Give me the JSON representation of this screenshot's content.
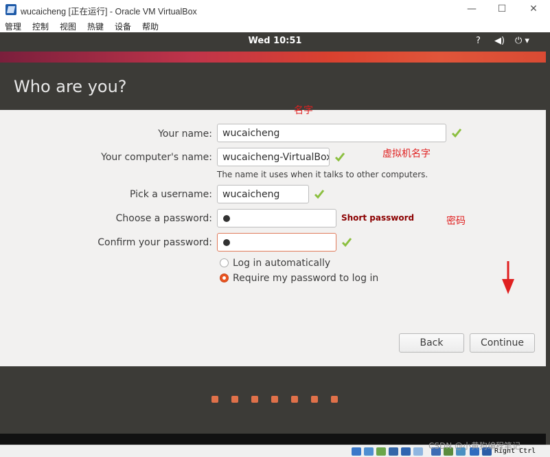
{
  "window": {
    "title": "wucaicheng [正在运行] - Oracle VM VirtualBox",
    "controls": {
      "minimize": "—",
      "maximize": "☐",
      "close": "✕"
    }
  },
  "menu": [
    "管理",
    "控制",
    "视图",
    "热键",
    "设备",
    "帮助"
  ],
  "topbar": {
    "clock": "Wed 10:51"
  },
  "installer": {
    "heading": "Who are you?",
    "your_name": {
      "label": "Your name:",
      "value": "wucaicheng"
    },
    "computer_name": {
      "label": "Your computer's name:",
      "value": "wucaicheng-VirtualBox",
      "hint": "The name it uses when it talks to other computers."
    },
    "username": {
      "label": "Pick a username:",
      "value": "wucaicheng"
    },
    "password": {
      "label": "Choose a password:",
      "strength": "Short password"
    },
    "confirm": {
      "label": "Confirm your password:"
    },
    "login_options": [
      {
        "label": "Log in automatically",
        "selected": false
      },
      {
        "label": "Require my password to log in",
        "selected": true
      }
    ],
    "back_label": "Back",
    "continue_label": "Continue",
    "progress_dots": 7
  },
  "annotations": {
    "name": "名字",
    "vm_name": "虚拟机名字",
    "password": "密码"
  },
  "colors": {
    "accent": "#e95420",
    "check": "#8bbf3f",
    "annotation": "#e02020"
  },
  "statusbar": {
    "host_key": "Right Ctrl",
    "watermark": "CSDN @小黄狗编程笔记"
  }
}
